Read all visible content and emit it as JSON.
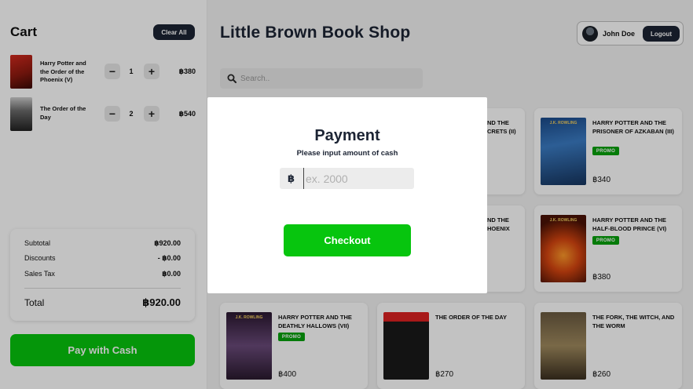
{
  "cart": {
    "title": "Cart",
    "clear_label": "Clear All",
    "currency": "฿",
    "items": [
      {
        "name": "Harry Potter and the Order of the Phoenix (V)",
        "qty": "1",
        "price": "฿380"
      },
      {
        "name": "The Order of the Day",
        "qty": "2",
        "price": "฿540"
      }
    ],
    "summary": {
      "subtotal_label": "Subtotal",
      "subtotal": "฿920.00",
      "discounts_label": "Discounts",
      "discounts": "- ฿0.00",
      "tax_label": "Sales Tax",
      "tax": "฿0.00",
      "total_label": "Total",
      "total": "฿920.00"
    },
    "pay_label": "Pay with Cash"
  },
  "header": {
    "shop_title": "Little Brown Book Shop",
    "user_name": "John Doe",
    "logout_label": "Logout",
    "search_placeholder": "Search.."
  },
  "books": [
    {
      "name": "HARRY POTTER AND THE PRISONER OF AZKABAN (III)",
      "promo": "PROMO",
      "price": "฿340"
    },
    {
      "name": "HARRY POTTER AND THE HALF-BLOOD PRINCE (VI)",
      "promo": "PROMO",
      "price": "฿380"
    },
    {
      "name": "HARRY POTTER AND THE DEATHLY HALLOWS (VII)",
      "promo": "PROMO",
      "price": "฿400"
    },
    {
      "name": "THE ORDER OF THE DAY",
      "price": "฿270"
    },
    {
      "name": "THE FORK, THE WITCH, AND THE WORM",
      "price": "฿260"
    }
  ],
  "partial_titles": {
    "row1": "ND THE\nCRETS (II)",
    "row2": "ND THE\nHOENIX"
  },
  "modal": {
    "title": "Payment",
    "subtitle": "Please input amount of cash",
    "currency_symbol": "฿",
    "placeholder": "ex. 2000",
    "checkout_label": "Checkout"
  },
  "colors": {
    "accent_green": "#07c50e",
    "promo_green": "#07a20c",
    "dark_navy": "#1c2434"
  }
}
